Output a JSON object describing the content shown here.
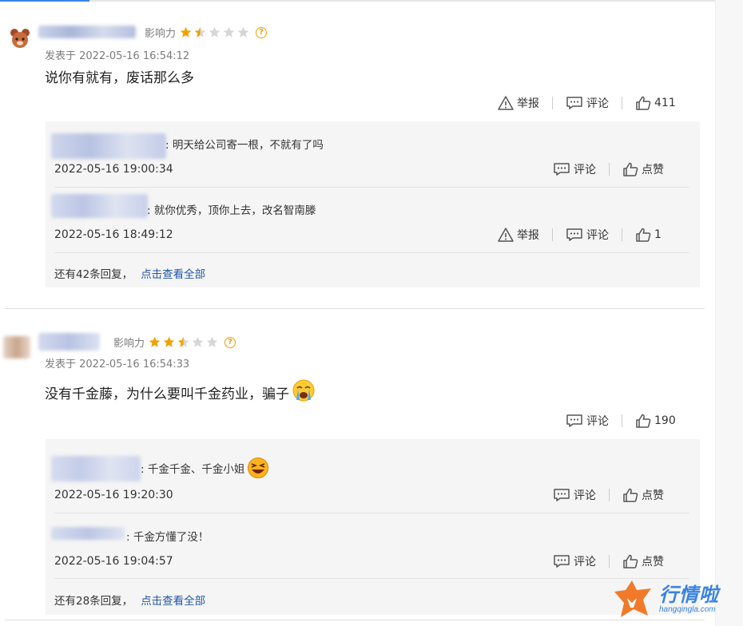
{
  "labels": {
    "influence": "影响力",
    "report": "举报",
    "comment": "评论",
    "like": "点赞",
    "view_all": "点击查看全部"
  },
  "comments": [
    {
      "rating": 1.5,
      "posted": "发表于 2022-05-16 16:54:12",
      "text": "说你有就有，废话那么多",
      "likes": "411",
      "replies": [
        {
          "text": ": 明天给公司寄一根，不就有了吗",
          "time": "2022-05-16 19:00:34"
        },
        {
          "text": ": 就你优秀，顶你上去，改名智南滕",
          "time": "2022-05-16 18:49:12",
          "likes": "1"
        }
      ],
      "more": "还有42条回复，"
    },
    {
      "rating": 2.5,
      "posted": "发表于 2022-05-16 16:54:33",
      "text": "没有千金藤，为什么要叫千金药业，骗子",
      "likes": "190",
      "replies": [
        {
          "text": ": 千金千金、千金小姐",
          "time": "2022-05-16 19:20:30"
        },
        {
          "text": ": 千金方懂了没！",
          "time": "2022-05-16 19:04:57"
        }
      ],
      "more": "还有28条回复，"
    }
  ],
  "watermark": {
    "name": "行情啦",
    "domain": "hangqingla.com"
  },
  "colors": {
    "star": "#f3a100",
    "link": "#2256a8",
    "watermark": "#3a82e0"
  },
  "icons": [
    "report-icon",
    "comment-icon",
    "like-icon",
    "help-icon",
    "star-icon"
  ]
}
